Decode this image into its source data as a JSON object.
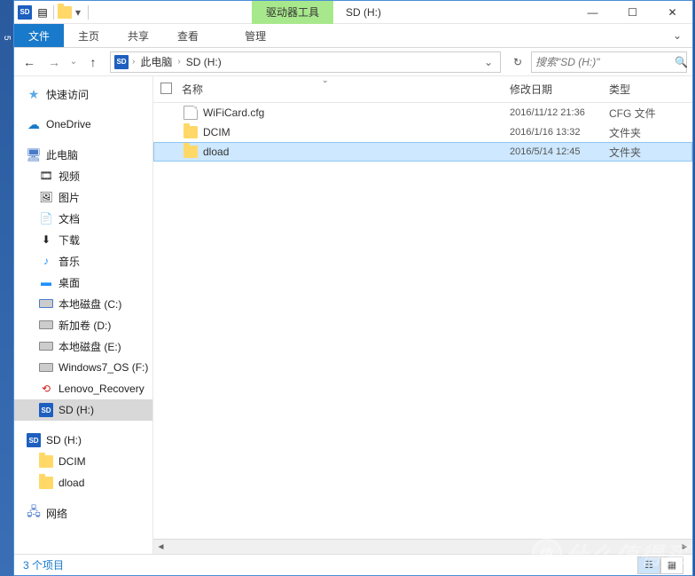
{
  "titlebar": {
    "contextual_group": "驱动器工具",
    "title": "SD (H:)"
  },
  "ribbon": {
    "file": "文件",
    "home": "主页",
    "share": "共享",
    "view": "查看",
    "manage": "管理"
  },
  "nav": {
    "crumb_pc": "此电脑",
    "crumb_sd": "SD (H:)",
    "search_placeholder": "搜索\"SD (H:)\""
  },
  "tree": {
    "quick_access": "快速访问",
    "onedrive": "OneDrive",
    "this_pc": "此电脑",
    "videos": "视频",
    "pictures": "图片",
    "documents": "文档",
    "downloads": "下载",
    "music": "音乐",
    "desktop": "桌面",
    "local_c": "本地磁盘 (C:)",
    "local_d": "新加卷 (D:)",
    "local_e": "本地磁盘 (E:)",
    "local_f": "Windows7_OS (F:)",
    "recovery": "Lenovo_Recovery",
    "sd_h": "SD (H:)",
    "sd_h2": "SD (H:)",
    "dcim": "DCIM",
    "dload": "dload",
    "network": "网络"
  },
  "columns": {
    "name": "名称",
    "date": "修改日期",
    "type": "类型"
  },
  "files": [
    {
      "name": "WiFiCard.cfg",
      "date": "2016/11/12 21:36",
      "type": "CFG 文件",
      "kind": "file"
    },
    {
      "name": "DCIM",
      "date": "2016/1/16 13:32",
      "type": "文件夹",
      "kind": "folder"
    },
    {
      "name": "dload",
      "date": "2016/5/14 12:45",
      "type": "文件夹",
      "kind": "folder",
      "selected": true
    }
  ],
  "status": {
    "count": "3 个项目"
  },
  "watermark": "什么值得买"
}
